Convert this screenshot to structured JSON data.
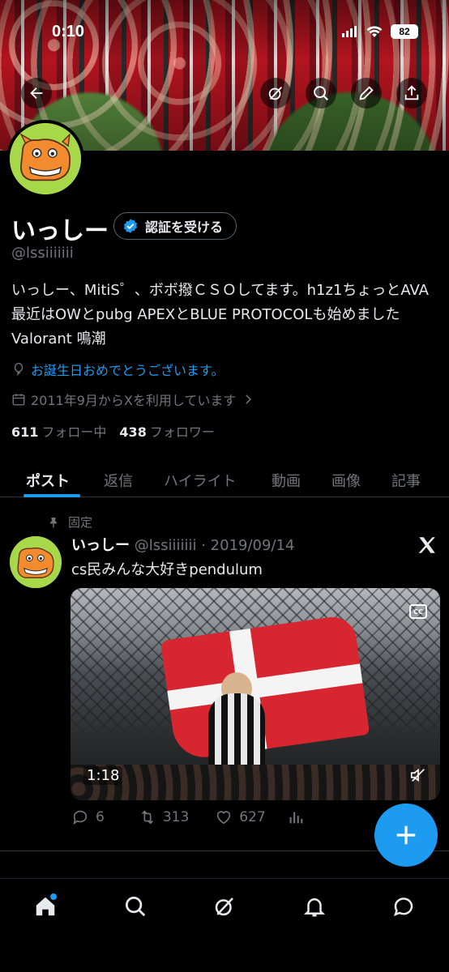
{
  "status_bar": {
    "time": "0:10",
    "battery": "82"
  },
  "profile": {
    "name": "いっしー",
    "handle": "@lssiiiiiii",
    "verify_label": "認証を受ける",
    "bio": "いっしー、MitiS゜、ボボ撥ＣＳＯしてます。h1z1ちょっとAVA 最近はOWとpubg APEXとBLUE PROTOCOLも始めました Valorant 鳴潮",
    "birthday_text": "お誕生日おめでとうございます。",
    "joined_text": "2011年9月からXを利用しています",
    "following_count": "611",
    "following_label": "フォロー中",
    "followers_count": "438",
    "followers_label": "フォロワー"
  },
  "tabs": [
    {
      "label": "ポスト",
      "active": true
    },
    {
      "label": "返信"
    },
    {
      "label": "ハイライト"
    },
    {
      "label": "動画"
    },
    {
      "label": "画像"
    },
    {
      "label": "記事"
    }
  ],
  "pinned_tweet": {
    "pinned_label": "固定",
    "author_name": "いっしー",
    "author_sub": "@lssiiiiiii · 2019/09/14",
    "text": "cs民みんな大好きpendulum",
    "video_duration": "1:18",
    "cc_label": "CC",
    "replies": "6",
    "retweets": "313",
    "likes": "627"
  },
  "icons": {
    "back": "arrow-left-icon",
    "grok": "grok-icon",
    "search": "search-icon",
    "edit": "pencil-icon",
    "share": "share-icon",
    "fab": "plus-icon",
    "nav": [
      "home-icon",
      "search-icon",
      "grok-icon",
      "bell-icon",
      "messages-icon"
    ]
  },
  "colors": {
    "accent": "#1d9bf0",
    "background": "#000000",
    "secondary_text": "#71767b"
  }
}
